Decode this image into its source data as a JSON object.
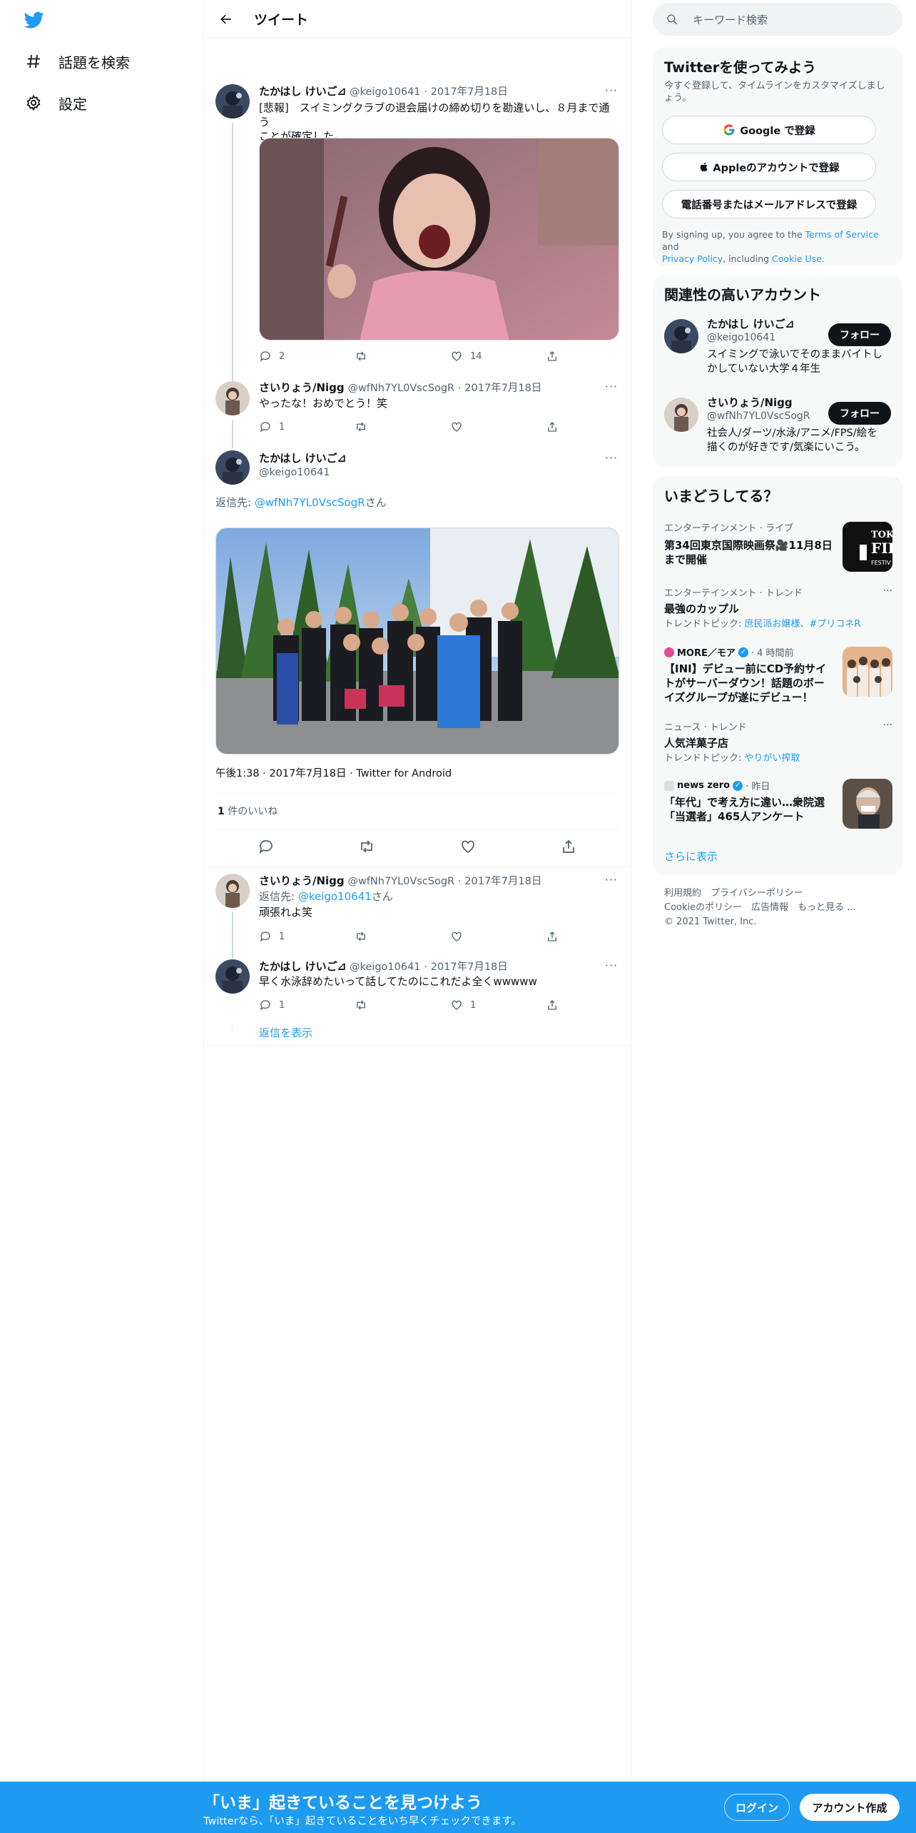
{
  "nav": {
    "items": [
      {
        "label": "話題を検索",
        "icon": "hashtag-icon"
      },
      {
        "label": "設定",
        "icon": "gear-icon"
      }
    ]
  },
  "header": {
    "title": "ツイート"
  },
  "tweets": [
    {
      "name": "たかはし けいご⊿",
      "handle": "@keigo10641",
      "date": "2017年7月18日",
      "text_line1": "[悲報]　スイミングクラブの退会届けの締め切りを勘違いし、８月まで通う",
      "text_line2": "ことが確定した。",
      "replies": "2",
      "retweets": "",
      "likes": "14"
    },
    {
      "name": "さいりょう/Nigg",
      "handle": "@wfNh7YL0VscSogR",
      "date": "2017年7月18日",
      "text": "やったな！おめでとう！笑",
      "replies": "1",
      "retweets": "",
      "likes": ""
    }
  ],
  "main_tweet": {
    "name": "たかはし けいご⊿",
    "handle": "@keigo10641",
    "reply_to_prefix": "返信先: ",
    "reply_to_handle": "@wfNh7YL0VscSogR",
    "reply_to_suffix": "さん",
    "timestamp": "午後1:38 · 2017年7月18日 · Twitter for Android",
    "likes_count": "1",
    "likes_label": " 件のいいね"
  },
  "replies": [
    {
      "name": "さいりょう/Nigg",
      "handle": "@wfNh7YL0VscSogR",
      "date": "2017年7月18日",
      "reply_prefix": "返信先: ",
      "reply_handle": "@keigo10641",
      "reply_suffix": "さん",
      "text": "頑張れよ笑",
      "replies": "1",
      "likes": ""
    },
    {
      "name": "たかはし けいご⊿",
      "handle": "@keigo10641",
      "date": "2017年7月18日",
      "text": "早く水泳辞めたいって話してたのにこれだよ全くwwwww",
      "replies": "1",
      "likes": "1"
    }
  ],
  "show_replies": "返信を表示",
  "search": {
    "placeholder": "キーワード検索"
  },
  "signup_card": {
    "title": "Twitterを使ってみよう",
    "subtitle_line1": "今すぐ登録して、タイムラインをカスタマイズしまし",
    "subtitle_line2": "ょう。",
    "google": "Google で登録",
    "apple": "Appleのアカウントで登録",
    "phone": "電話番号またはメールアドレスで登録",
    "terms_prefix": "By signing up, you agree to the ",
    "terms": "Terms of Service",
    "and": " and",
    "privacy": "Privacy Policy",
    "including": ", including ",
    "cookie": "Cookie Use."
  },
  "related_card": {
    "title": "関連性の高いアカウント",
    "accounts": [
      {
        "name": "たかはし けいご⊿",
        "handle": "@keigo10641",
        "bio_line1": "スイミングで泳いでそのままバイトし",
        "bio_line2": "かしていない大学４年生",
        "follow": "フォロー"
      },
      {
        "name": "さいりょう/Nigg",
        "handle": "@wfNh7YL0VscSogR",
        "bio_line1": "社会人/ダーツ/水泳/アニメ/FPS/絵を",
        "bio_line2": "描くのが好きです/気楽にいこう。",
        "follow": "フォロー"
      }
    ]
  },
  "trends_card": {
    "title": "いまどうしてる？",
    "items": [
      {
        "category": "エンターテインメント · ライブ",
        "title_line1": "第34回東京国際映画祭🎥11月8日",
        "title_line2": "まで開催",
        "sub": ""
      },
      {
        "category": "エンターテインメント · トレンド",
        "title_line1": "最強のカップル",
        "title_line2": "",
        "sub_prefix": "トレンドトピック: ",
        "sub": "庶民派お嬢様、#プリコネR"
      },
      {
        "category": "MORE／モア",
        "time": " · 4 時間前",
        "title_line1": "【INI】デビュー前にCD予約サイ",
        "title_line2": "トがサーバーダウン！話題のボー",
        "title_line3": "イズグループが遂にデビュー！"
      },
      {
        "category": "ニュース · トレンド",
        "title_line1": "人気洋菓子店",
        "sub_prefix": "トレンドトピック: ",
        "sub": "やりがい搾取"
      },
      {
        "category": "news zero",
        "time": " · 昨日",
        "title_line1": "「年代」で考え方に違い…衆院選",
        "title_line2": "「当選者」465人アンケート"
      }
    ],
    "show_more": "さらに表示"
  },
  "footer": {
    "line1": "利用規約　プライバシーポリシー",
    "line2": "Cookieのポリシー　広告情報　もっと見る ...",
    "line3": "© 2021 Twitter, Inc."
  },
  "bottom_bar": {
    "title": "「いま」起きていることを見つけよう",
    "subtitle": "Twitterなら、「いま」起きていることをいち早くチェックできます。",
    "login": "ログイン",
    "signup": "アカウント作成"
  },
  "colors": {
    "accent": "#1d9bf0",
    "text": "#0f1419",
    "muted": "#536471"
  }
}
